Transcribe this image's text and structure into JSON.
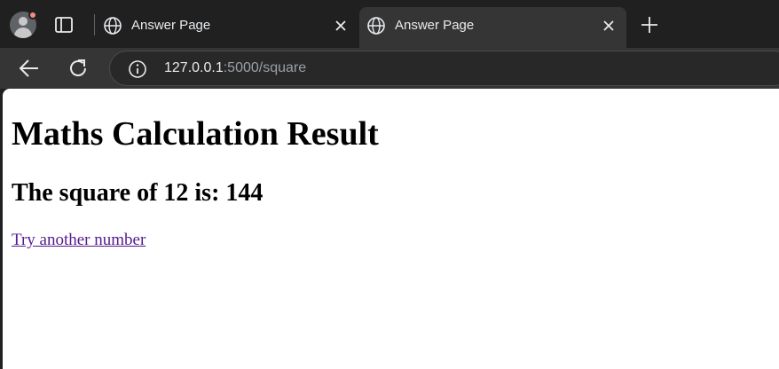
{
  "browser": {
    "tabs": [
      {
        "title": "Answer Page",
        "active": false
      },
      {
        "title": "Answer Page",
        "active": true
      }
    ],
    "address_bar": {
      "host": "127.0.0.1",
      "path": ":5000/square"
    }
  },
  "page": {
    "heading": "Maths Calculation Result",
    "result_text": "The square of 12 is: 144",
    "link_text": "Try another number"
  }
}
